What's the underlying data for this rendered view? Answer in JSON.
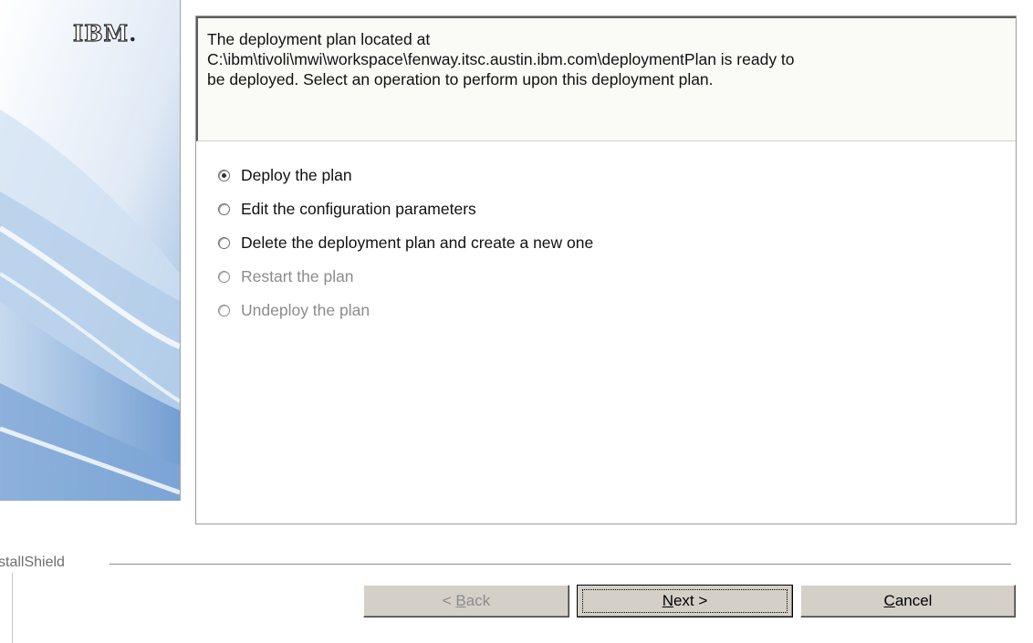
{
  "branding": {
    "logo_text": "IBM",
    "logo_dot": ".",
    "installer_label": "stallShield"
  },
  "message": {
    "line1": "The deployment plan located at",
    "line2": "C:\\ibm\\tivoli\\mwi\\workspace\\fenway.itsc.austin.ibm.com\\deploymentPlan is ready to",
    "line3": "be deployed. Select an operation to perform upon this deployment plan."
  },
  "options": [
    {
      "label": "Deploy the plan",
      "checked": true,
      "enabled": true
    },
    {
      "label": "Edit the configuration parameters",
      "checked": false,
      "enabled": true
    },
    {
      "label": "Delete the deployment plan and create a new one",
      "checked": false,
      "enabled": true
    },
    {
      "label": "Restart the plan",
      "checked": false,
      "enabled": false
    },
    {
      "label": "Undeploy the plan",
      "checked": false,
      "enabled": false
    }
  ],
  "buttons": {
    "back": {
      "prefix": "< ",
      "mnemonic": "B",
      "rest": "ack",
      "enabled": false
    },
    "next": {
      "prefix": "",
      "mnemonic": "N",
      "rest": "ext >",
      "enabled": true
    },
    "cancel": {
      "prefix": "",
      "mnemonic": "C",
      "rest": "ancel",
      "enabled": true
    }
  },
  "colors": {
    "button_face": "#d4d0c8",
    "disabled_text": "#8c8c8c",
    "panel_accent": "#6e9bd0"
  }
}
